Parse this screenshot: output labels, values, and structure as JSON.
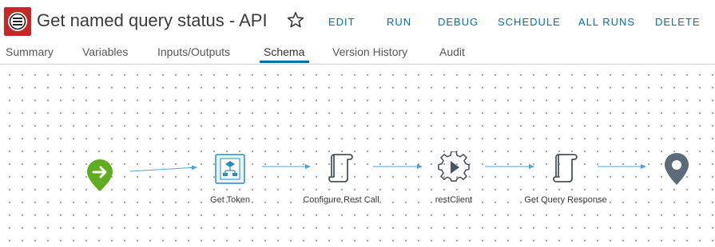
{
  "header": {
    "title": "Get named query status - API",
    "actions": {
      "edit": "EDIT",
      "run": "RUN",
      "debug": "DEBUG",
      "schedule": "SCHEDULE",
      "all_runs": "ALL RUNS",
      "delete": "DELETE"
    }
  },
  "tabs": {
    "summary": "Summary",
    "variables": "Variables",
    "inputs_outputs": "Inputs/Outputs",
    "schema": "Schema",
    "version_history": "Version History",
    "audit": "Audit",
    "active": "Schema"
  },
  "schema": {
    "nodes": [
      {
        "type": "start",
        "label": "",
        "icon": "arrow-right-pin-icon"
      },
      {
        "type": "workflow",
        "label": "Get Token",
        "icon": "workflow-element-icon"
      },
      {
        "type": "script",
        "label": "Configure Rest Call",
        "icon": "scroll-icon"
      },
      {
        "type": "action",
        "label": "restClient",
        "icon": "gear-play-icon"
      },
      {
        "type": "script",
        "label": "Get Query Response",
        "icon": "scroll-icon"
      },
      {
        "type": "end",
        "label": "",
        "icon": "location-pin-icon"
      }
    ]
  },
  "colors": {
    "accent": "#0072a3",
    "start": "#5fac1f",
    "end": "#5b6b79",
    "app_icon": "#c62828",
    "connector": "#4fa3d6"
  }
}
